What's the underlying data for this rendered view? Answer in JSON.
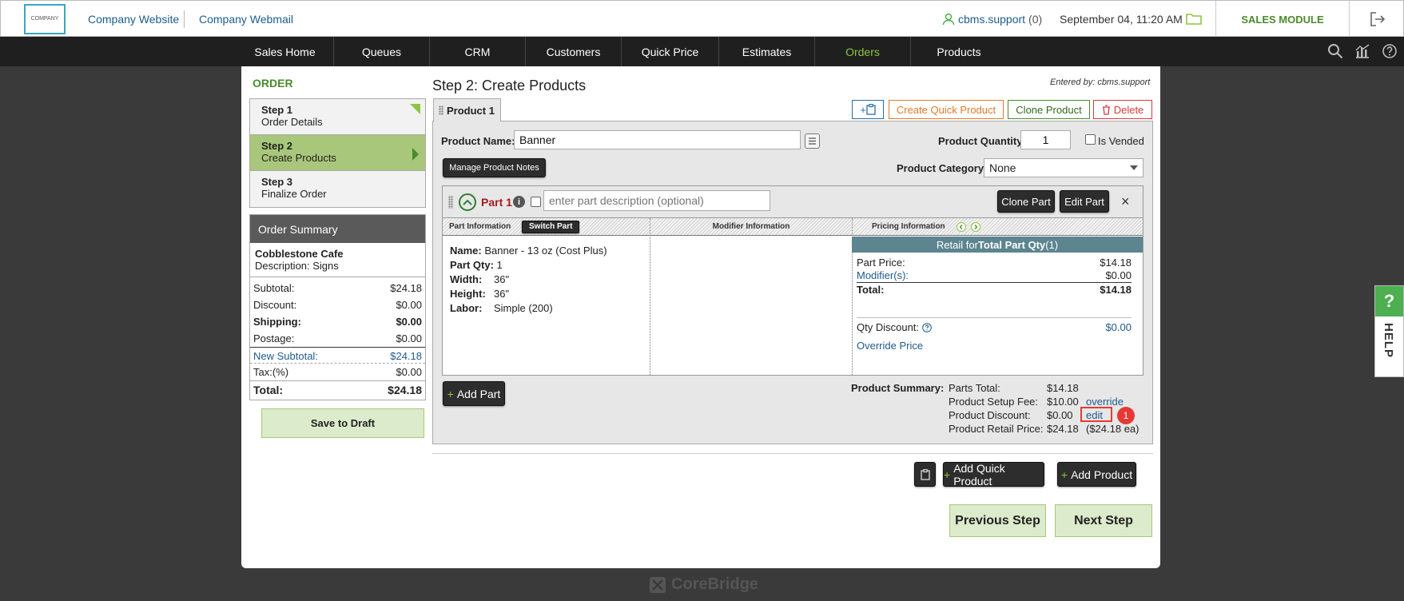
{
  "topbar": {
    "logo_text": "COMPANY",
    "company_website": "Company Website",
    "company_webmail": "Company Webmail",
    "user": "cbms.support",
    "user_count": "(0)",
    "datetime": "September 04, 11:20 AM",
    "module": "SALES MODULE"
  },
  "nav": {
    "items": [
      "Sales Home",
      "Queues",
      "CRM",
      "Customers",
      "Quick Price",
      "Estimates",
      "Orders",
      "Products"
    ],
    "active": "Orders"
  },
  "sidebar": {
    "title": "ORDER",
    "steps": [
      {
        "num": "Step 1",
        "label": "Order Details"
      },
      {
        "num": "Step 2",
        "label": "Create Products"
      },
      {
        "num": "Step 3",
        "label": "Finalize Order"
      }
    ],
    "summary": {
      "head": "Order Summary",
      "customer": "Cobblestone Cafe",
      "description": "Description:  Signs",
      "rows": [
        {
          "label": "Subtotal:",
          "value": "$24.18"
        },
        {
          "label": "Discount:",
          "value": "$0.00"
        },
        {
          "label": "Shipping:",
          "value": "$0.00"
        },
        {
          "label": "Postage:",
          "value": "$0.00"
        },
        {
          "label": "New Subtotal:",
          "value": "$24.18"
        },
        {
          "label": "Tax:(%)",
          "value": "$0.00"
        },
        {
          "label": "Total:",
          "value": "$24.18"
        }
      ]
    },
    "save_draft": "Save to Draft"
  },
  "main": {
    "title": "Step 2: Create Products",
    "entered_by": "Entered by: cbms.support",
    "tab": "Product 1",
    "buttons": {
      "add_icon": "+",
      "create_quick": "Create Quick Product",
      "clone_product": "Clone Product",
      "delete": "Delete"
    },
    "product_name_label": "Product Name:",
    "product_name_value": "Banner",
    "quantity_label": "Product Quantity:",
    "quantity_value": "1",
    "is_vended": "Is Vended",
    "manage_notes": "Manage Product Notes",
    "category_label": "Product Category:",
    "category_value": "None",
    "part": {
      "title": "Part 1",
      "desc_placeholder": "enter part description (optional)",
      "clone_part": "Clone Part",
      "edit_part": "Edit Part",
      "close": "×",
      "col_part_info": "Part Information",
      "switch_part": "Switch Part",
      "col_modifier": "Modifier Information",
      "col_pricing": "Pricing Information",
      "info": [
        {
          "k": "Name:",
          "v": "Banner - 13 oz (Cost Plus)"
        },
        {
          "k": "Part Qty:",
          "v": "1"
        },
        {
          "k": "Width:",
          "v": "36\""
        },
        {
          "k": "Height:",
          "v": "36\""
        },
        {
          "k": "Labor:",
          "v": "Simple (200)"
        }
      ],
      "pricing_head_pre": "Retail for ",
      "pricing_head_bold": "Total Part Qty",
      "pricing_head_post": " (1)",
      "part_price_label": "Part Price:",
      "part_price": "$14.18",
      "modifiers_label": "Modifier(s):",
      "modifiers": "$0.00",
      "total_label": "Total:",
      "total": "$14.18",
      "qty_discount_label": "Qty Discount:",
      "qty_discount": "$0.00",
      "override_price": "Override Price"
    },
    "add_part": "Add Part",
    "summary": {
      "label": "Product Summary:",
      "parts_total_label": "Parts Total:",
      "parts_total": "$14.18",
      "setup_fee_label": "Product Setup Fee:",
      "setup_fee": "$10.00",
      "override": "override",
      "discount_label": "Product Discount:",
      "discount": "$0.00",
      "edit": "edit",
      "badge": "1",
      "retail_label": "Product Retail Price:",
      "retail": "$24.18",
      "retail_each": "($24.18 ea)"
    },
    "add_quick_product": "Add Quick Product",
    "add_product": "Add Product",
    "previous_step": "Previous Step",
    "next_step": "Next Step"
  },
  "footer_brand": "CoreBridge",
  "help": "HELP",
  "colors": {
    "accent_green": "#4a8b2c",
    "nav_bg": "#1f1f1f",
    "link_blue": "#1e5b8a",
    "alert_red": "#e53935"
  }
}
